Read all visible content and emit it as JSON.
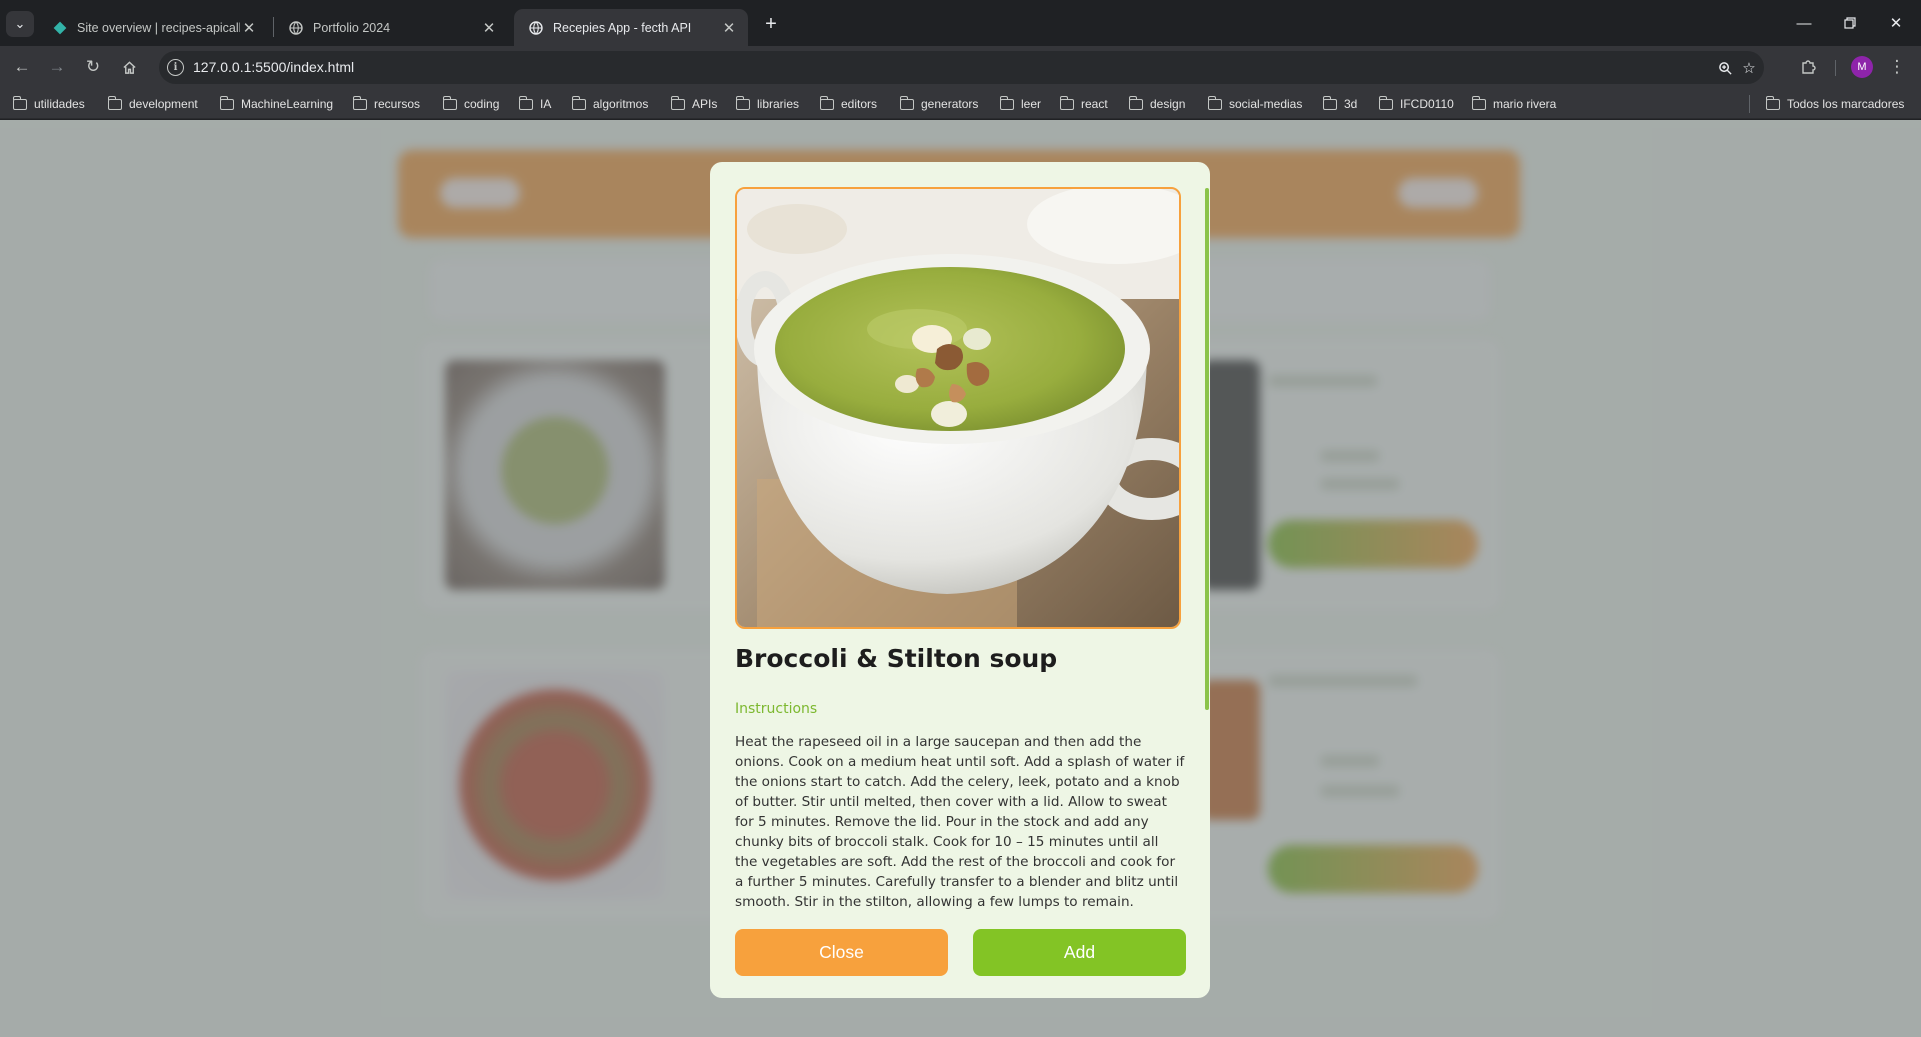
{
  "browser": {
    "tabs": [
      {
        "title": "Site overview | recipes-apicall |",
        "favicon": "netlify-diamond-icon",
        "active": false
      },
      {
        "title": "Portfolio 2024",
        "favicon": "globe-icon",
        "active": false
      },
      {
        "title": "Recepies App - fecth API",
        "favicon": "globe-icon",
        "active": true
      }
    ],
    "url": "127.0.0.1:5500/index.html",
    "profile_initial": "M",
    "bookmarks": [
      "utilidades",
      "development",
      "MachineLearning",
      "recursos",
      "coding",
      "IA",
      "algoritmos",
      "APIs",
      "libraries",
      "editors",
      "generators",
      "leer",
      "react",
      "design",
      "social-medias",
      "3d",
      "IFCD0110",
      "mario rivera"
    ],
    "all_bookmarks": "Todos los marcadores",
    "icons": {
      "tab_search": "chevron-down-icon",
      "new_tab": "plus-icon",
      "back": "back-arrow-icon",
      "forward": "forward-arrow-icon",
      "reload": "reload-icon",
      "home": "home-icon",
      "site_info": "info-icon",
      "zoom": "zoom-icon",
      "star": "star-icon",
      "extensions": "puzzle-icon",
      "menu": "kebab-menu-icon",
      "minimize": "minimize-icon",
      "restore": "restore-icon",
      "close": "close-icon"
    }
  },
  "modal": {
    "title": "Broccoli & Stilton soup",
    "instructions_label": "Instructions",
    "instructions": "Heat the rapeseed oil in a large saucepan and then add the onions. Cook on a medium heat until soft. Add a splash of water if the onions start to catch. Add the celery, leek, potato and a knob of butter. Stir until melted, then cover with a lid. Allow to sweat for 5 minutes. Remove the lid. Pour in the stock and add any chunky bits of broccoli stalk. Cook for 10 – 15 minutes until all the vegetables are soft. Add the rest of the broccoli and cook for a further 5 minutes. Carefully transfer to a blender and blitz until smooth. Stir in the stilton, allowing a few lumps to remain. Season",
    "close_label": "Close",
    "add_label": "Add"
  },
  "colors": {
    "accent_orange": "#f7a13d",
    "accent_green": "#83c425",
    "modal_bg": "#eef6e5",
    "instructions_label": "#7cb82f"
  }
}
